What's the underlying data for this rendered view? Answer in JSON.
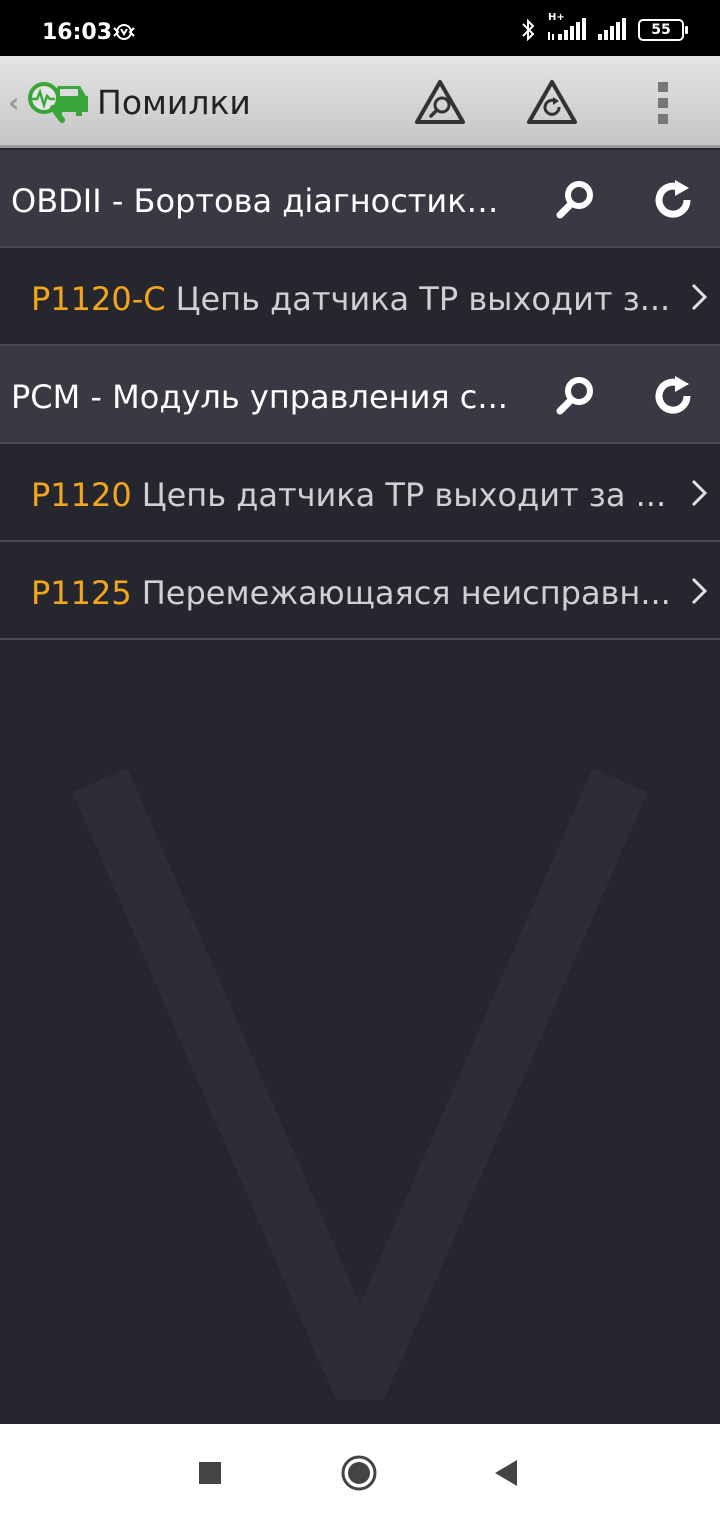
{
  "status_bar": {
    "time": "16:03",
    "network_type": "H+",
    "battery_level": "55",
    "icons": [
      "app-notification-icon",
      "bluetooth-icon",
      "signal-icon",
      "signal-icon",
      "battery-icon"
    ]
  },
  "app_bar": {
    "title": "Помилки",
    "icons": [
      "back-chevron-icon",
      "app-logo-icon",
      "search-warning-icon",
      "refresh-warning-icon",
      "overflow-menu-icon"
    ]
  },
  "groups": [
    {
      "title": "OBDII - Бортова діагностика...",
      "codes": [
        {
          "code": "P1120-C",
          "description": "Цепь датчика TP выходит з..."
        }
      ]
    },
    {
      "title": "PCM - Модуль управления с...",
      "codes": [
        {
          "code": "P1120",
          "description": "Цепь датчика TP выходит за ..."
        },
        {
          "code": "P1125",
          "description": "Перемежающаяся неисправн..."
        }
      ]
    }
  ],
  "colors": {
    "accent": "#f3a51b",
    "background": "#25262e",
    "header": "#383943",
    "logo_green": "#3aa63a"
  }
}
